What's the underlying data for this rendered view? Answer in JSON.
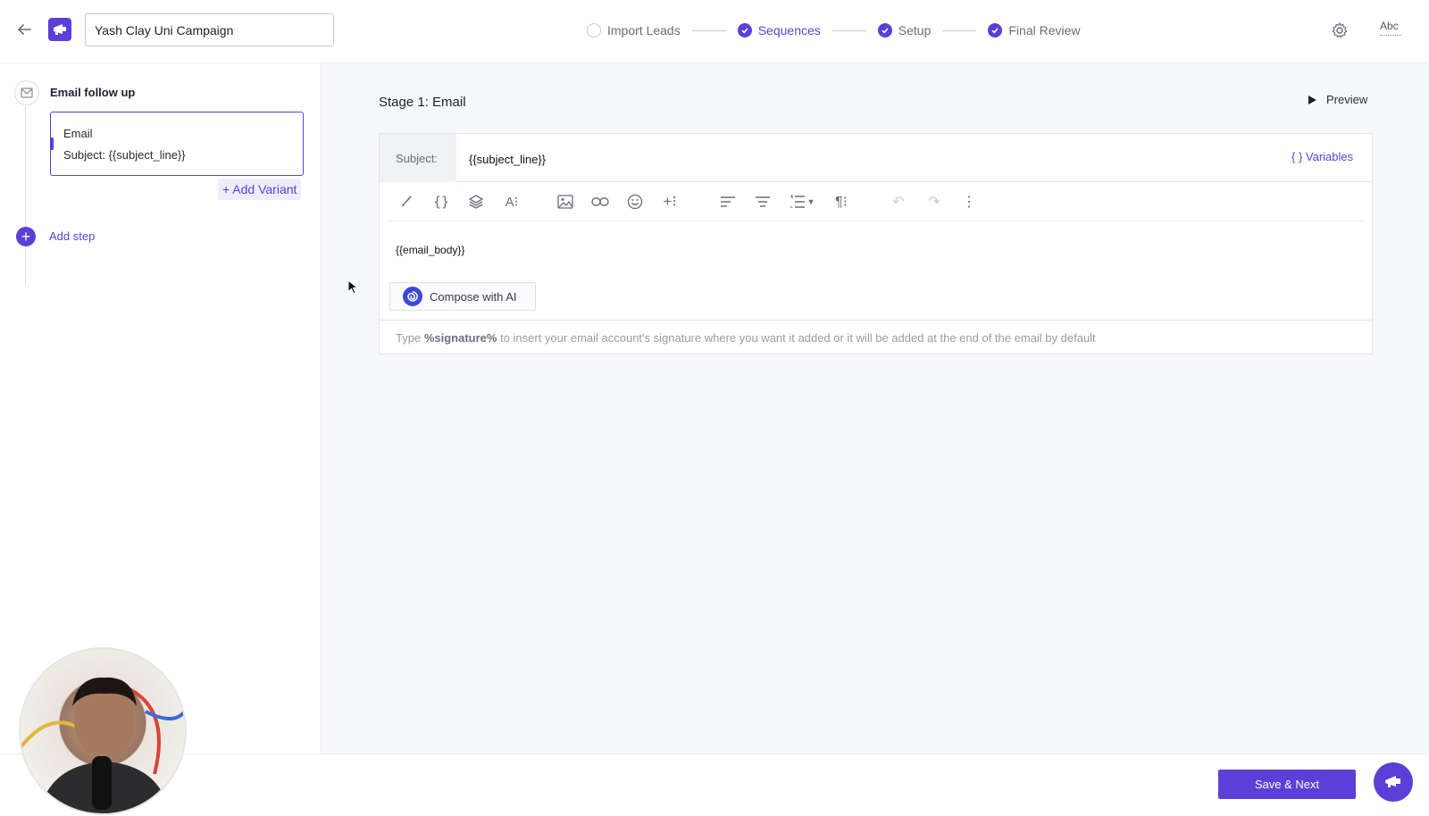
{
  "header": {
    "campaign_name": "Yash Clay Uni Campaign",
    "steps": [
      {
        "label": "Import Leads",
        "done": false
      },
      {
        "label": "Sequences",
        "done": true,
        "active": true
      },
      {
        "label": "Setup",
        "done": true
      },
      {
        "label": "Final Review",
        "done": true
      }
    ],
    "spellcheck_label": "Abc"
  },
  "sidebar": {
    "sequence_title": "Email follow up",
    "variant": {
      "type": "Email",
      "subject": "Subject: {{subject_line}}"
    },
    "add_variant_label": "+ Add Variant",
    "add_step_label": "Add step"
  },
  "main": {
    "stage_title": "Stage 1: Email",
    "preview_label": "Preview",
    "subject_label": "Subject:",
    "subject_value": "{{subject_line}}",
    "variables_label": "{ } Variables",
    "body_text": "{{email_body}}",
    "compose_ai_label": "Compose with AI",
    "signature_prefix": "Type",
    "signature_token": "%signature%",
    "signature_suffix": "to insert your email account's signature where you want it added or it will be added at the end of the email by default"
  },
  "footer": {
    "save_next_label": "Save & Next"
  },
  "colors": {
    "accent": "#5b3fd6",
    "background": "#f7f8fb"
  }
}
